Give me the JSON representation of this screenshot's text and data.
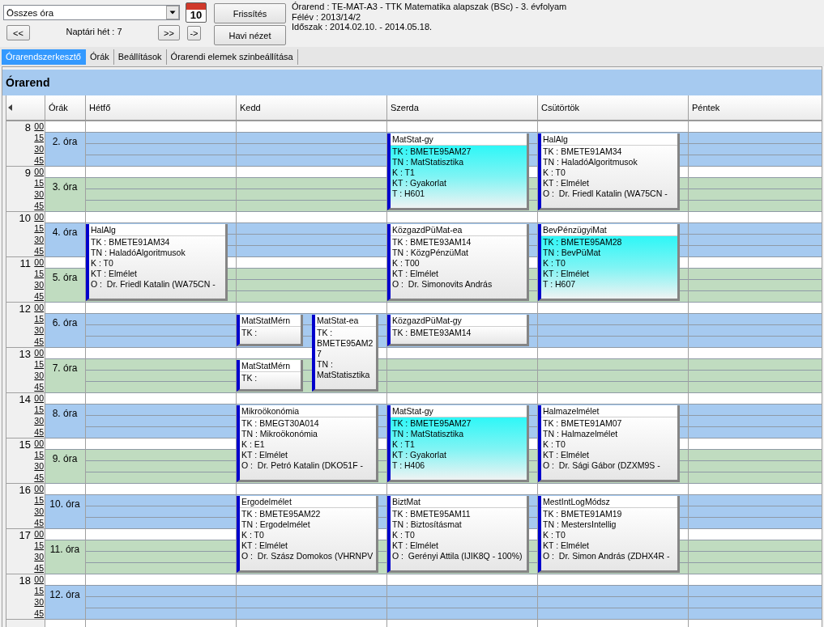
{
  "toolbar": {
    "filter_dropdown": {
      "value": "Összes óra"
    },
    "calendar_button": {
      "label": "10"
    },
    "prev_week_button": {
      "label": "<<"
    },
    "week_label": "Naptári hét : 7",
    "next_week_button": {
      "label": ">>"
    },
    "go_button": {
      "label": "->"
    },
    "refresh_button": {
      "label": "Frissítés"
    },
    "month_view_button": {
      "label": "Havi nézet"
    },
    "info_lines": [
      "Órarend : TE-MAT-A3 - TTK Matematika alapszak (BSc) - 3. évfolyam",
      "Félév : 2013/14/2",
      "Időszak : 2014.02.10. - 2014.05.18."
    ]
  },
  "tabs": [
    {
      "label": "Órarendszerkesztő",
      "selected": true
    },
    {
      "label": "Órák",
      "selected": false
    },
    {
      "label": "Beállítások",
      "selected": false
    },
    {
      "label": "Órarendi elemek szinbeállítása",
      "selected": false
    }
  ],
  "timetable": {
    "title": "Órarend",
    "period_column": "Órák",
    "hours": [
      {
        "hour": "8",
        "minutes": [
          "00",
          "15",
          "30",
          "45"
        ],
        "period": {
          "label": "2. óra",
          "color": "#a6caf0"
        }
      },
      {
        "hour": "9",
        "minutes": [
          "00",
          "15",
          "30",
          "45"
        ],
        "period": {
          "label": "3. óra",
          "color": "#c0dcc0"
        }
      },
      {
        "hour": "10",
        "minutes": [
          "00",
          "15",
          "30",
          "45"
        ],
        "period": {
          "label": "4. óra",
          "color": "#a6caf0"
        }
      },
      {
        "hour": "11",
        "minutes": [
          "00",
          "15",
          "30",
          "45"
        ],
        "period": {
          "label": "5. óra",
          "color": "#c0dcc0"
        }
      },
      {
        "hour": "12",
        "minutes": [
          "00",
          "15",
          "30",
          "45"
        ],
        "period": {
          "label": "6. óra",
          "color": "#a6caf0"
        }
      },
      {
        "hour": "13",
        "minutes": [
          "00",
          "15",
          "30",
          "45"
        ],
        "period": {
          "label": "7. óra",
          "color": "#c0dcc0"
        }
      },
      {
        "hour": "14",
        "minutes": [
          "00",
          "15",
          "30",
          "45"
        ],
        "period": {
          "label": "8. óra",
          "color": "#a6caf0"
        }
      },
      {
        "hour": "15",
        "minutes": [
          "00",
          "15",
          "30",
          "45"
        ],
        "period": {
          "label": "9. óra",
          "color": "#c0dcc0"
        }
      },
      {
        "hour": "16",
        "minutes": [
          "00",
          "15",
          "30",
          "45"
        ],
        "period": {
          "label": "10. óra",
          "color": "#a6caf0"
        }
      },
      {
        "hour": "17",
        "minutes": [
          "00",
          "15",
          "30",
          "45"
        ],
        "period": {
          "label": "11. óra",
          "color": "#c0dcc0"
        }
      },
      {
        "hour": "18",
        "minutes": [
          "00",
          "15",
          "30",
          "45"
        ],
        "period": {
          "label": "12. óra",
          "color": "#a6caf0"
        }
      }
    ],
    "days": [
      {
        "name": "Hétfő",
        "slots": [
          {
            "kind": "free"
          },
          {
            "kind": "free"
          },
          {
            "kind": "double",
            "title": "HalAlg",
            "highlighted": false,
            "fields": [
              "TK : BMETE91AM34",
              "TN : HaladóAlgoritmusok",
              "K : T0",
              "KT : Elmélet",
              "O :  Dr. Friedl Katalin (WA75CN -"
            ]
          }
        ]
      },
      {
        "name": "Kedd",
        "slots": [
          {
            "kind": "free"
          },
          {
            "kind": "free"
          },
          {
            "kind": "free"
          },
          {
            "kind": "free"
          },
          {
            "kind": "parallel",
            "lanes": [
              [
                {
                  "kind": "single",
                  "title": "MatStatMérn",
                  "highlighted": false,
                  "fields": [
                    "TK :"
                  ]
                },
                {
                  "kind": "single",
                  "title": "MatStatMérn",
                  "highlighted": false,
                  "fields": [
                    "TK :"
                  ]
                }
              ],
              [
                {
                  "kind": "double",
                  "title": "MatStat-ea",
                  "highlighted": false,
                  "fields": [
                    "TK : BMETE95AM27",
                    "TN : MatStatisztika"
                  ]
                }
              ]
            ]
          },
          {
            "kind": "double",
            "title": "Mikroökonómia",
            "highlighted": false,
            "fields": [
              "TK : BMEGT30A014",
              "TN : Mikroökonómia",
              "K : E1",
              "KT : Elmélet",
              "O :  Dr. Petró Katalin (DKO51F -"
            ]
          },
          {
            "kind": "double",
            "title": "Ergodelmélet",
            "highlighted": false,
            "fields": [
              "TK : BMETE95AM22",
              "TN : Ergodelmélet",
              "K : T0",
              "KT : Elmélet",
              "O :  Dr. Szász Domokos (VHRNPV"
            ]
          }
        ]
      },
      {
        "name": "Szerda",
        "slots": [
          {
            "kind": "double",
            "title": "MatStat-gy",
            "highlighted": true,
            "fields": [
              "TK : BMETE95AM27",
              "TN : MatStatisztika",
              "K : T1",
              "KT : Gyakorlat",
              "T : H601"
            ]
          },
          {
            "kind": "double",
            "title": "KözgazdPüMat-ea",
            "highlighted": false,
            "fields": [
              "TK : BMETE93AM14",
              "TN : KözgPénzüMat",
              "K : T00",
              "KT : Elmélet",
              "O :  Dr. Simonovits András"
            ]
          },
          {
            "kind": "single",
            "title": "KözgazdPüMat-gy",
            "highlighted": false,
            "fields": [
              "TK : BMETE93AM14"
            ]
          },
          {
            "kind": "free"
          },
          {
            "kind": "double",
            "title": "MatStat-gy",
            "highlighted": true,
            "fields": [
              "TK : BMETE95AM27",
              "TN : MatStatisztika",
              "K : T1",
              "KT : Gyakorlat",
              "T : H406"
            ]
          },
          {
            "kind": "double",
            "title": "BiztMat",
            "highlighted": false,
            "fields": [
              "TK : BMETE95AM11",
              "TN : Biztosításmat",
              "K : T0",
              "KT : Elmélet",
              "O :  Gerényi Attila (IJIK8Q - 100%)"
            ]
          }
        ]
      },
      {
        "name": "Csütörtök",
        "slots": [
          {
            "kind": "double",
            "title": "HalAlg",
            "highlighted": false,
            "fields": [
              "TK : BMETE91AM34",
              "TN : HaladóAlgoritmusok",
              "K : T0",
              "KT : Elmélet",
              "O :  Dr. Friedl Katalin (WA75CN -"
            ]
          },
          {
            "kind": "double",
            "title": "BevPénzügyiMat",
            "highlighted": true,
            "fields": [
              "TK : BMETE95AM28",
              "TN : BevPüMat",
              "K : T0",
              "KT : Elmélet",
              "T : H607"
            ]
          },
          {
            "kind": "free"
          },
          {
            "kind": "free"
          },
          {
            "kind": "double",
            "title": "Halmazelmélet",
            "highlighted": false,
            "fields": [
              "TK : BMETE91AM07",
              "TN : Halmazelmélet",
              "K : T0",
              "KT : Elmélet",
              "O :  Dr. Sági Gábor (DZXM9S -"
            ]
          },
          {
            "kind": "double",
            "title": "MestIntLogMódsz",
            "highlighted": false,
            "fields": [
              "TK : BMETE91AM19",
              "TN : MestersIntellig",
              "K : T0",
              "KT : Elmélet",
              "O :  Dr. Simon András (ZDHX4R -"
            ]
          }
        ]
      },
      {
        "name": "Péntek"
      }
    ]
  }
}
